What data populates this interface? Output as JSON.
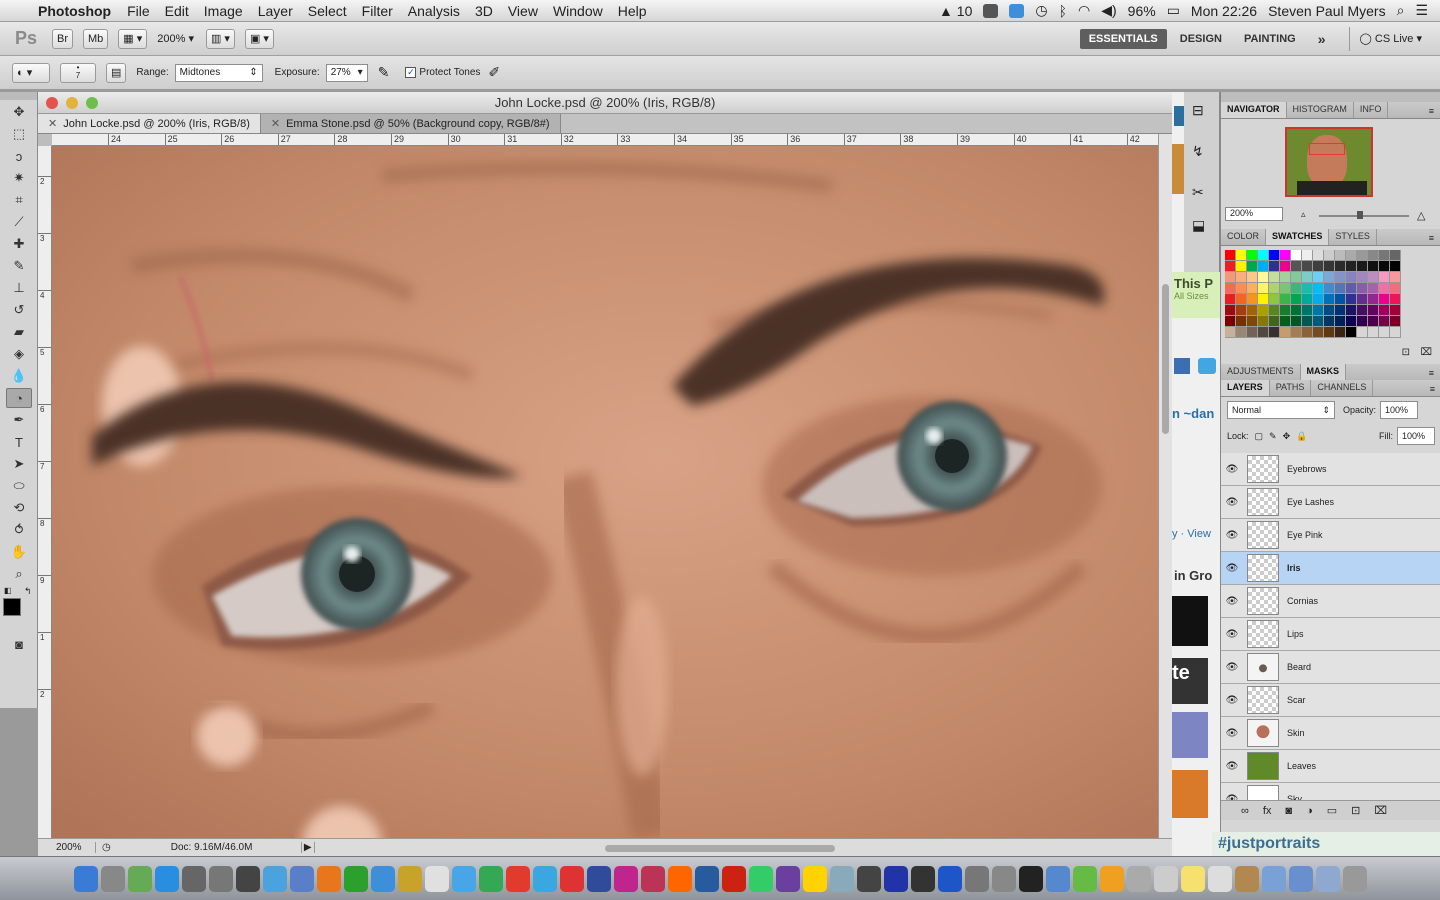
{
  "menubar": {
    "app": "Photoshop",
    "items": [
      "File",
      "Edit",
      "Image",
      "Layer",
      "Select",
      "Filter",
      "Analysis",
      "3D",
      "View",
      "Window",
      "Help"
    ],
    "status": {
      "adobe_badge": "10",
      "battery": "96%",
      "clock": "Mon 22:26",
      "user": "Steven Paul Myers"
    }
  },
  "appbar": {
    "ps_logo": "Ps",
    "br": "Br",
    "mb": "Mb",
    "zoom": "200%",
    "workspaces": [
      "ESSENTIALS",
      "DESIGN",
      "PAINTING"
    ],
    "more": "»",
    "cslive": "CS Live"
  },
  "options": {
    "brush_size": "7",
    "range_label": "Range:",
    "range_value": "Midtones",
    "exposure_label": "Exposure:",
    "exposure_value": "27%",
    "protect_tones": "Protect Tones"
  },
  "document": {
    "title": "John Locke.psd @ 200% (Iris, RGB/8)",
    "tabs": [
      {
        "label": "John Locke.psd @ 200% (Iris, RGB/8)",
        "active": true
      },
      {
        "label": "Emma Stone.psd @ 50% (Background copy, RGB/8#)",
        "active": false
      }
    ],
    "ruler_h": [
      "24",
      "25",
      "26",
      "27",
      "28",
      "29",
      "30",
      "31",
      "32",
      "33",
      "34",
      "35",
      "36",
      "37",
      "38",
      "39",
      "40",
      "41",
      "42"
    ],
    "ruler_v": [
      "2",
      "3",
      "4",
      "5",
      "6",
      "7",
      "8",
      "9",
      "1",
      "2"
    ],
    "status_zoom": "200%",
    "status_doc": "Doc: 9.16M/46.0M"
  },
  "panels": {
    "nav_tabs": [
      "NAVIGATOR",
      "HISTOGRAM",
      "INFO"
    ],
    "nav_zoom": "200%",
    "color_tabs": [
      "COLOR",
      "SWATCHES",
      "STYLES"
    ],
    "adj_tabs": [
      "ADJUSTMENTS",
      "MASKS"
    ],
    "layer_tabs": [
      "LAYERS",
      "PATHS",
      "CHANNELS"
    ],
    "blend_mode": "Normal",
    "opacity_label": "Opacity:",
    "opacity": "100%",
    "lock_label": "Lock:",
    "fill_label": "Fill:",
    "fill": "100%",
    "layers": [
      {
        "name": "Eyebrows",
        "selected": false,
        "thumb": "transparent"
      },
      {
        "name": "Eye Lashes",
        "selected": false,
        "thumb": "transparent"
      },
      {
        "name": "Eye Pink",
        "selected": false,
        "thumb": "transparent"
      },
      {
        "name": "Iris",
        "selected": true,
        "thumb": "transparent"
      },
      {
        "name": "Cornias",
        "selected": false,
        "thumb": "transparent"
      },
      {
        "name": "Lips",
        "selected": false,
        "thumb": "transparent"
      },
      {
        "name": "Beard",
        "selected": false,
        "thumb": "beard"
      },
      {
        "name": "Scar",
        "selected": false,
        "thumb": "transparent"
      },
      {
        "name": "Skin",
        "selected": false,
        "thumb": "skin"
      },
      {
        "name": "Leaves",
        "selected": false,
        "thumb": "leaves"
      },
      {
        "name": "Sky",
        "selected": false,
        "thumb": "white"
      }
    ]
  },
  "browser_fragments": {
    "this_text": "This P",
    "sizes_text": "All Sizes",
    "tilde_text": "n ~dan",
    "view_text": "y · View",
    "group_text": "in Gro",
    "te_text": "te",
    "hashtag": "#justportraits"
  },
  "colors": {
    "skin": "#c7906f",
    "iris": "#6d8a8a",
    "brow": "#4b3327",
    "accent_selected": "#b8d4f4"
  }
}
